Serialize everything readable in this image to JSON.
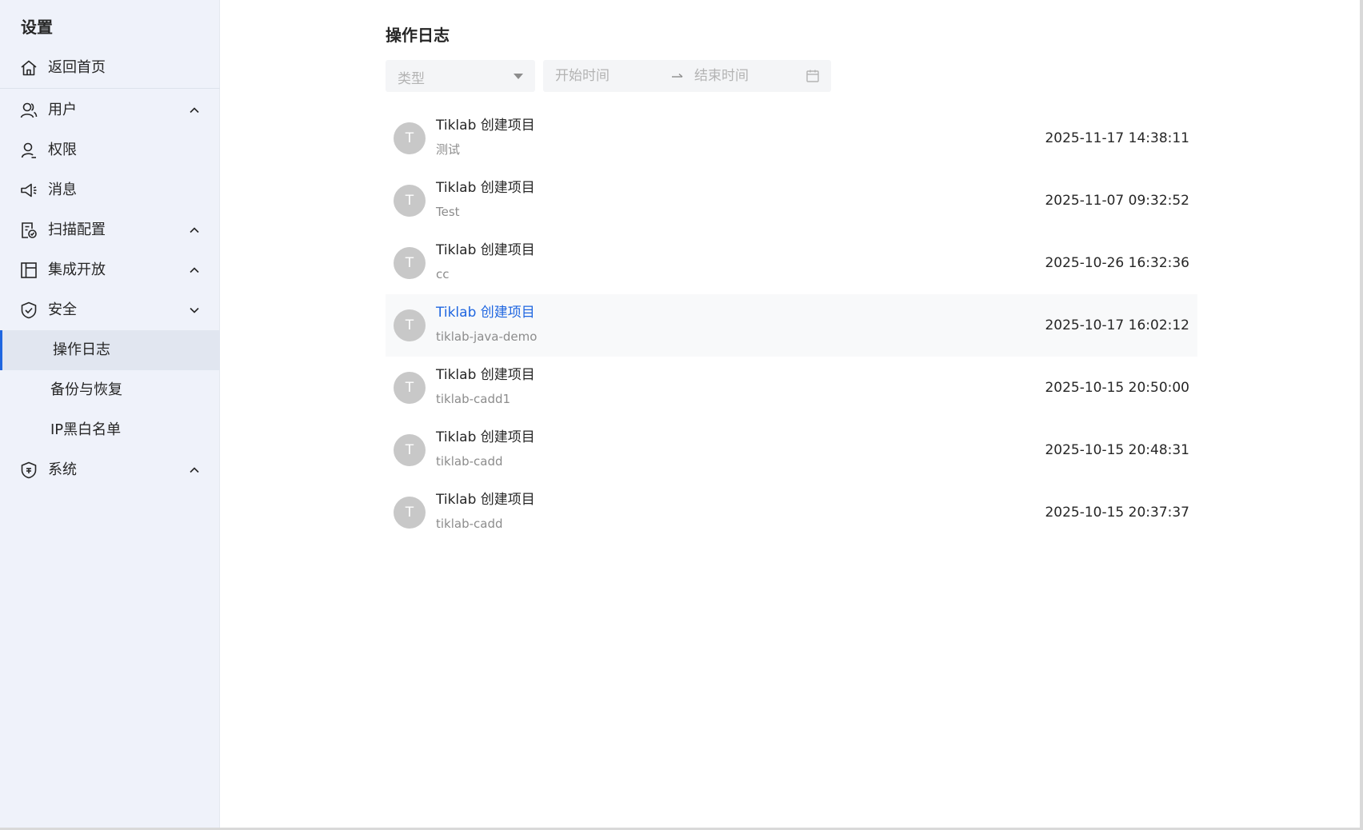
{
  "sidebar": {
    "title": "设置",
    "home": "返回首页",
    "user": "用户",
    "permission": "权限",
    "message": "消息",
    "scan_config": "扫描配置",
    "integration": "集成开放",
    "security": "安全",
    "security_children": [
      "操作日志",
      "备份与恢复",
      "IP黑白名单"
    ],
    "system": "系统"
  },
  "main": {
    "title": "操作日志",
    "type_placeholder": "类型",
    "start_placeholder": "开始时间",
    "end_placeholder": "结束时间",
    "logs": [
      {
        "avatar": "T",
        "title": "Tiklab 创建项目",
        "subtitle": "测试",
        "time": "2025-11-17 14:38:11"
      },
      {
        "avatar": "T",
        "title": "Tiklab 创建项目",
        "subtitle": "Test",
        "time": "2025-11-07 09:32:52"
      },
      {
        "avatar": "T",
        "title": "Tiklab 创建项目",
        "subtitle": "cc",
        "time": "2025-10-26 16:32:36"
      },
      {
        "avatar": "T",
        "title": "Tiklab 创建项目",
        "subtitle": "tiklab-java-demo",
        "time": "2025-10-17 16:02:12"
      },
      {
        "avatar": "T",
        "title": "Tiklab 创建项目",
        "subtitle": "tiklab-cadd1",
        "time": "2025-10-15 20:50:00"
      },
      {
        "avatar": "T",
        "title": "Tiklab 创建项目",
        "subtitle": "tiklab-cadd",
        "time": "2025-10-15 20:48:31"
      },
      {
        "avatar": "T",
        "title": "Tiklab 创建项目",
        "subtitle": "tiklab-cadd",
        "time": "2025-10-15 20:37:37"
      }
    ]
  },
  "colors": {
    "accent": "#1f66e0",
    "sidebar_bg": "#eff2fa",
    "active_bg": "#e1e6f0",
    "avatar_bg": "#c8c8c8"
  }
}
